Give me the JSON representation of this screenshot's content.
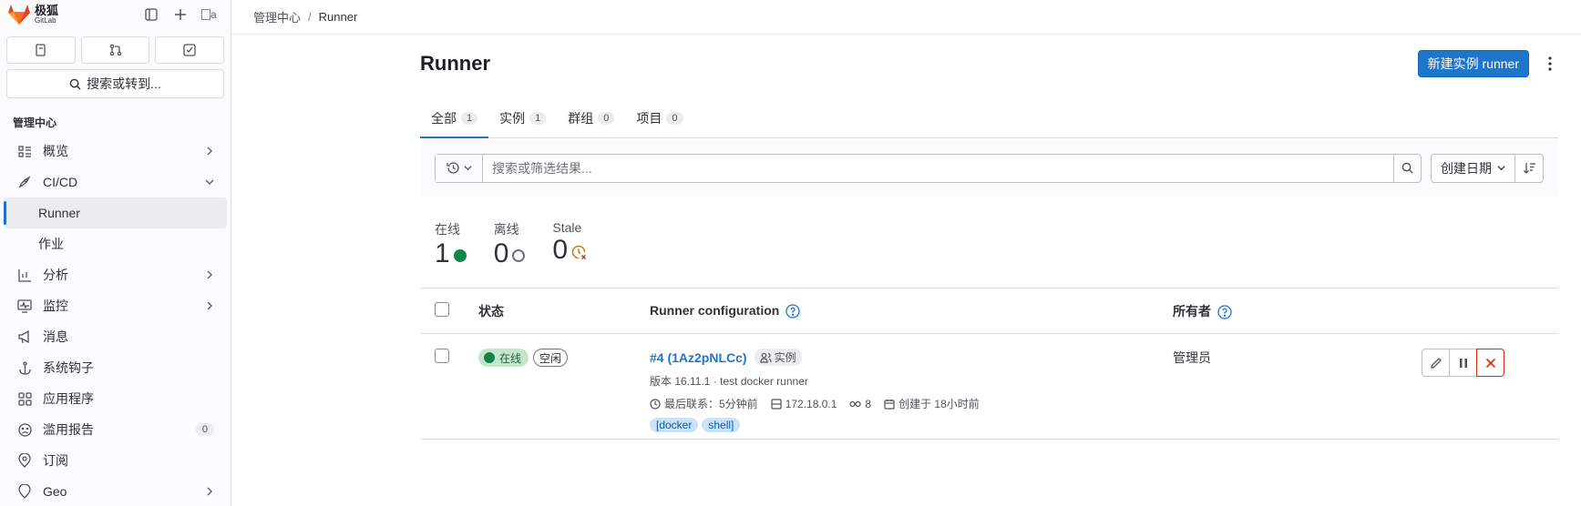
{
  "brand": {
    "name_cn": "极狐",
    "name_en": "GitLab",
    "avatar_alt": "a"
  },
  "sidebar": {
    "search_label": "搜索或转到...",
    "section_title": "管理中心",
    "items": [
      {
        "label": "概览"
      },
      {
        "label": "CI/CD"
      },
      {
        "label": "Runner"
      },
      {
        "label": "作业"
      },
      {
        "label": "分析"
      },
      {
        "label": "监控"
      },
      {
        "label": "消息"
      },
      {
        "label": "系统钩子"
      },
      {
        "label": "应用程序"
      },
      {
        "label": "滥用报告",
        "count": "0"
      },
      {
        "label": "订阅"
      },
      {
        "label": "Geo"
      }
    ]
  },
  "breadcrumb": {
    "root": "管理中心",
    "separator": "/",
    "current": "Runner"
  },
  "page": {
    "title": "Runner",
    "new_button": "新建实例 runner"
  },
  "tabs": [
    {
      "label": "全部",
      "count": "1"
    },
    {
      "label": "实例",
      "count": "1"
    },
    {
      "label": "群组",
      "count": "0"
    },
    {
      "label": "项目",
      "count": "0"
    }
  ],
  "filter": {
    "placeholder": "搜索或筛选结果...",
    "sort_label": "创建日期"
  },
  "stats": [
    {
      "label": "在线",
      "value": "1"
    },
    {
      "label": "离线",
      "value": "0"
    },
    {
      "label": "Stale",
      "value": "0"
    }
  ],
  "table": {
    "headers": {
      "status": "状态",
      "config": "Runner configuration",
      "owner": "所有者"
    },
    "rows": [
      {
        "status_online": "在线",
        "status_idle": "空闲",
        "name": "#4 (1Az2pNLCc)",
        "type_badge": "实例",
        "version": "版本 16.11.1 · test docker runner",
        "last_contact": "最后联系：5分钟前",
        "ip": "172.18.0.1",
        "jobs": "8",
        "created": "创建于 18小时前",
        "tags": [
          "[docker",
          "shell]"
        ],
        "owner": "管理员"
      }
    ]
  },
  "colors": {
    "primary": "#1f75cb",
    "online": "#108548",
    "danger": "#dd2b0e",
    "stale": "#c17d10"
  }
}
